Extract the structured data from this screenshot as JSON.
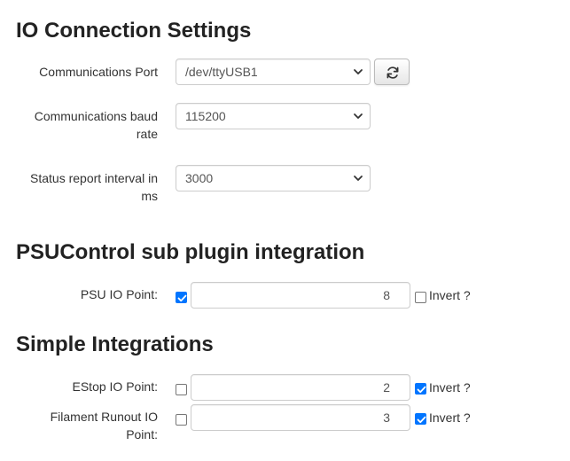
{
  "io_connection": {
    "title": "IO Connection Settings",
    "port": {
      "label": "Communications Port",
      "value": "/dev/ttyUSB1"
    },
    "baud": {
      "label_line1": "Communications baud",
      "label_line2": "rate",
      "value": "115200"
    },
    "interval": {
      "label_line1": "Status report interval in",
      "label_line2": "ms",
      "value": "3000"
    }
  },
  "psucontrol": {
    "title": "PSUControl sub plugin integration",
    "psu_io_point": {
      "label": "PSU IO Point:",
      "enabled": true,
      "value": "8",
      "invert_label": "Invert ?",
      "invert": false
    }
  },
  "simple": {
    "title": "Simple Integrations",
    "estop": {
      "label": "EStop IO Point:",
      "enabled": false,
      "value": "2",
      "invert_label": "Invert ?",
      "invert": true
    },
    "filament": {
      "label_line1": "Filament Runout IO",
      "label_line2": "Point:",
      "enabled": false,
      "value": "3",
      "invert_label": "Invert ?",
      "invert": true
    }
  },
  "icons": {
    "refresh": "refresh-icon",
    "select_caret": "chevron-down-icon",
    "checkmark": "checkmark-icon"
  },
  "colors": {
    "checkbox_checked": "#0075ff",
    "border": "#cccccc"
  }
}
